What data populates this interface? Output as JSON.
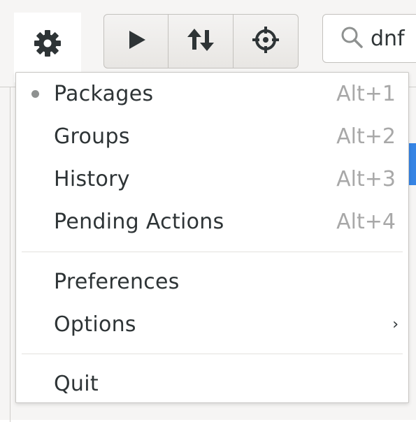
{
  "toolbar": {
    "gear_icon": "gear-icon",
    "apply_icon": "play-icon",
    "updates_icon": "up-down-arrows-icon",
    "target_icon": "crosshair-icon",
    "search": {
      "icon": "search-icon",
      "value": "dnf"
    }
  },
  "menu": {
    "items": [
      {
        "label": "Packages",
        "accel": "Alt+1",
        "selected": true
      },
      {
        "label": "Groups",
        "accel": "Alt+2"
      },
      {
        "label": "History",
        "accel": "Alt+3"
      },
      {
        "label": "Pending Actions",
        "accel": "Alt+4"
      },
      {
        "label": "Preferences",
        "accel": ""
      },
      {
        "label": "Options",
        "accel": "",
        "submenu_arrow": "›"
      },
      {
        "label": "Quit",
        "accel": ""
      }
    ]
  },
  "colors": {
    "selection_accent": "#3584e4",
    "accel_text": "#a8a8a8",
    "radio_dot": "#8e9190"
  }
}
